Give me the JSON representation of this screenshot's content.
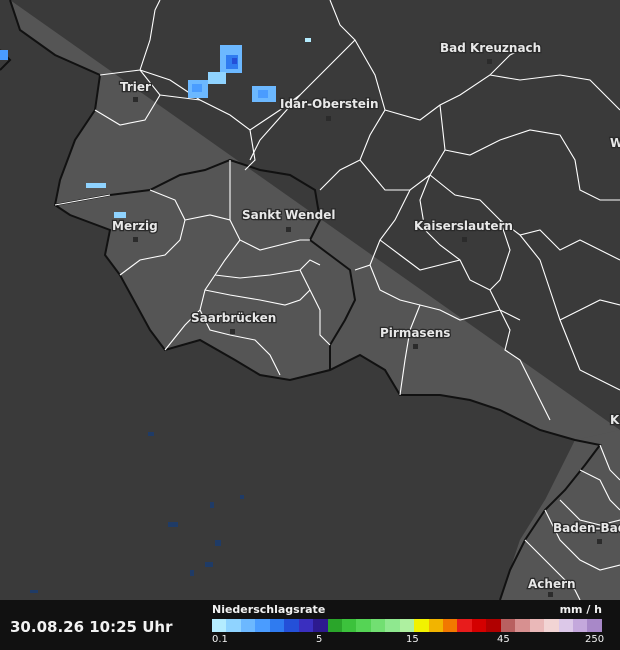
{
  "map": {
    "cities": [
      {
        "name": "Bad Kreuznach"
      },
      {
        "name": "Trier"
      },
      {
        "name": "Idar-Oberstein"
      },
      {
        "name": "Sankt Wendel"
      },
      {
        "name": "Merzig"
      },
      {
        "name": "Kaiserslautern"
      },
      {
        "name": "Saarbrücken"
      },
      {
        "name": "Pirmasens"
      },
      {
        "name": "Baden-Bad"
      },
      {
        "name": "Achern"
      }
    ],
    "edge_labels": [
      "W",
      "K"
    ]
  },
  "footer": {
    "timestamp": "30.08.26 10:25 Uhr",
    "legend_title": "Niederschlagsrate",
    "legend_unit": "mm / h",
    "ticks": [
      "0.1",
      "5",
      "15",
      "45",
      "250"
    ],
    "colors": [
      "#b4ecff",
      "#8fd3ff",
      "#6cb8ff",
      "#4a9cff",
      "#2f7bf0",
      "#2450d8",
      "#3a2fbf",
      "#2d1a8f",
      "#2aa52a",
      "#3cc23c",
      "#55d455",
      "#72df72",
      "#8fe88f",
      "#aef0a0",
      "#f2f200",
      "#f2b400",
      "#f27800",
      "#e81c1c",
      "#d40000",
      "#b00000",
      "#b86060",
      "#d79090",
      "#eab8b8",
      "#f2d4d4",
      "#dcc8e8",
      "#c4a8dc",
      "#a888c8"
    ]
  }
}
